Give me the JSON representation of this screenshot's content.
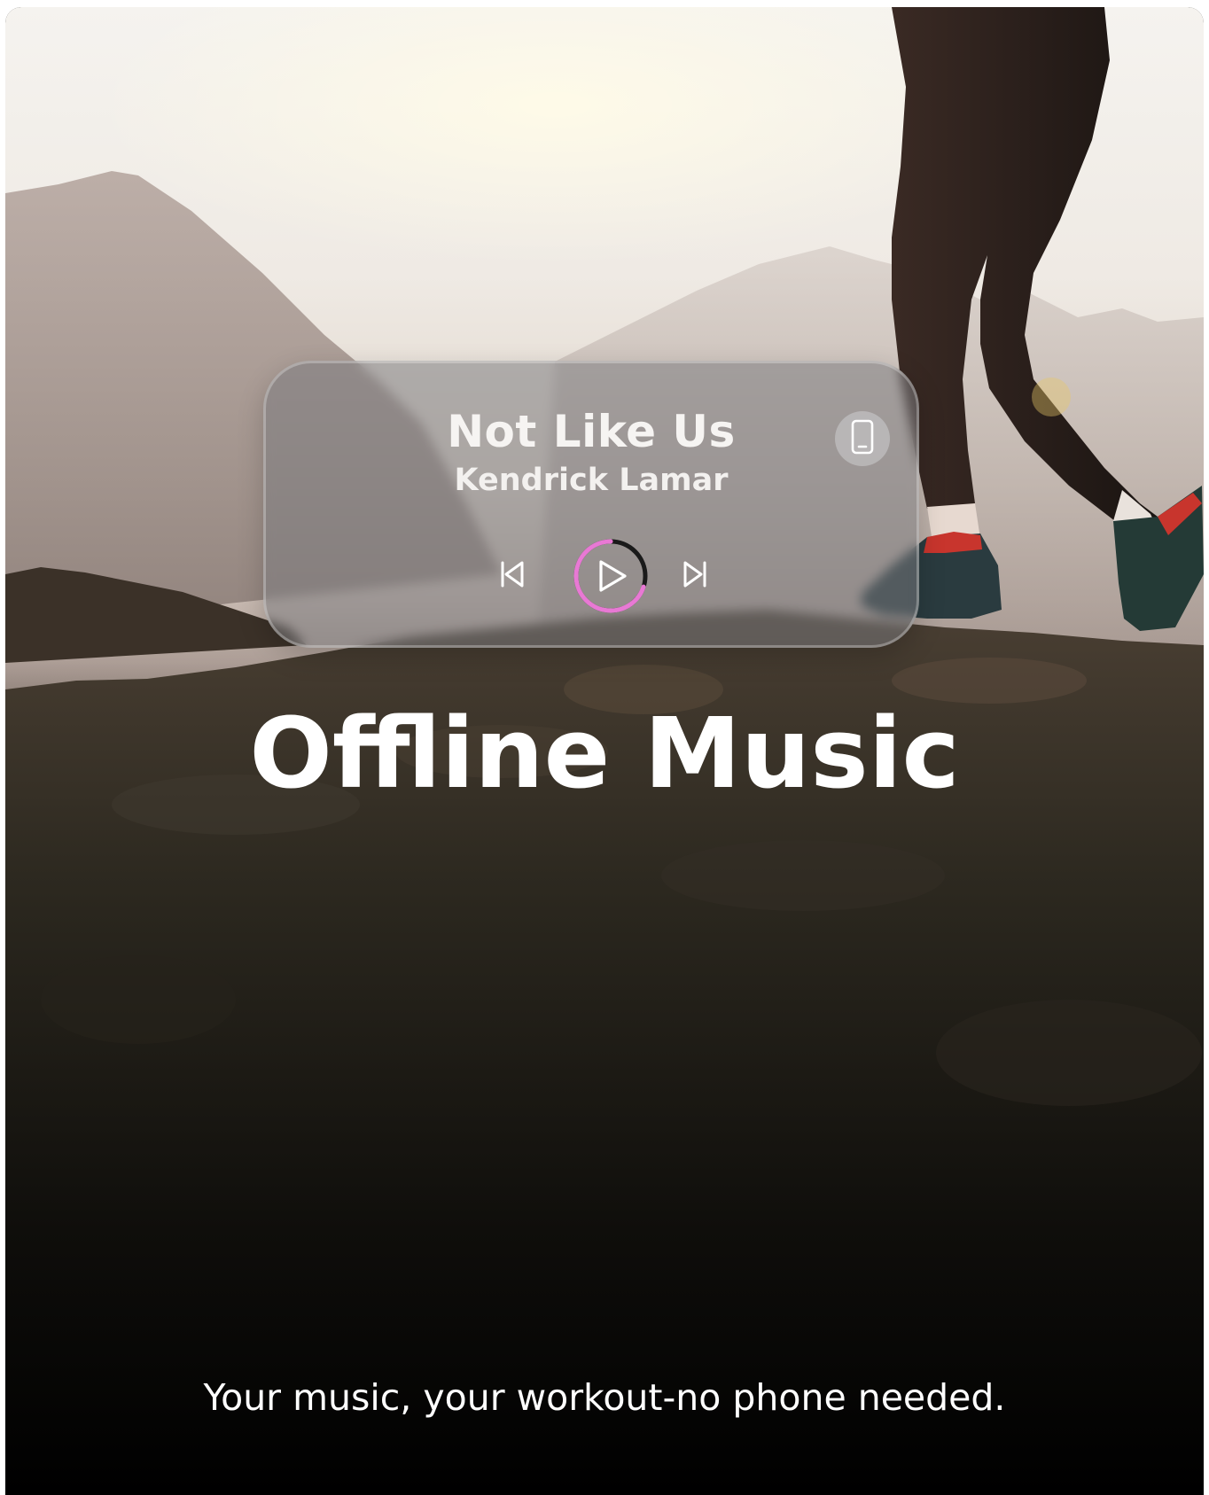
{
  "player": {
    "song_title": "Not Like Us",
    "artist": "Kendrick Lamar",
    "progress_fraction": 0.7,
    "accent_color": "#e879d4",
    "icons": {
      "device": "phone-icon",
      "previous": "skip-previous-icon",
      "play": "play-icon",
      "next": "skip-next-icon"
    }
  },
  "hero": {
    "headline": "Offline Music",
    "tagline": "Your music, your workout-no phone needed."
  }
}
